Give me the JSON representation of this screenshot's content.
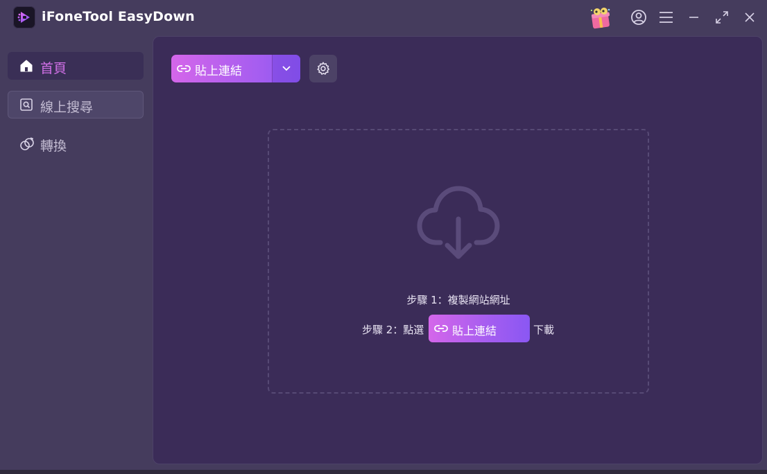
{
  "app": {
    "title": "iFoneTool EasyDown",
    "accent": "#d466ea",
    "accent_end": "#8a57f3"
  },
  "titlebar": {
    "icons": [
      "gift-icon",
      "account-icon",
      "menu-icon",
      "minimize-icon",
      "maximize-icon",
      "close-icon"
    ]
  },
  "sidebar": {
    "items": [
      {
        "label": "首頁",
        "icon": "home-icon",
        "active": true
      },
      {
        "label": "線上搜尋",
        "icon": "search-icon",
        "active": false
      },
      {
        "label": "轉換",
        "icon": "convert-icon",
        "active": false
      }
    ]
  },
  "toolbar": {
    "paste_label": "貼上連結",
    "paste_icon": "link-icon",
    "dropdown_icon": "chevron-down-icon",
    "settings_icon": "gear-icon"
  },
  "dropzone": {
    "icon": "cloud-download-icon",
    "step1": "步驟 1：複製網站網址",
    "step2_prefix": "步驟 2：點選",
    "step2_button": "貼上連結",
    "step2_suffix": "下載"
  }
}
